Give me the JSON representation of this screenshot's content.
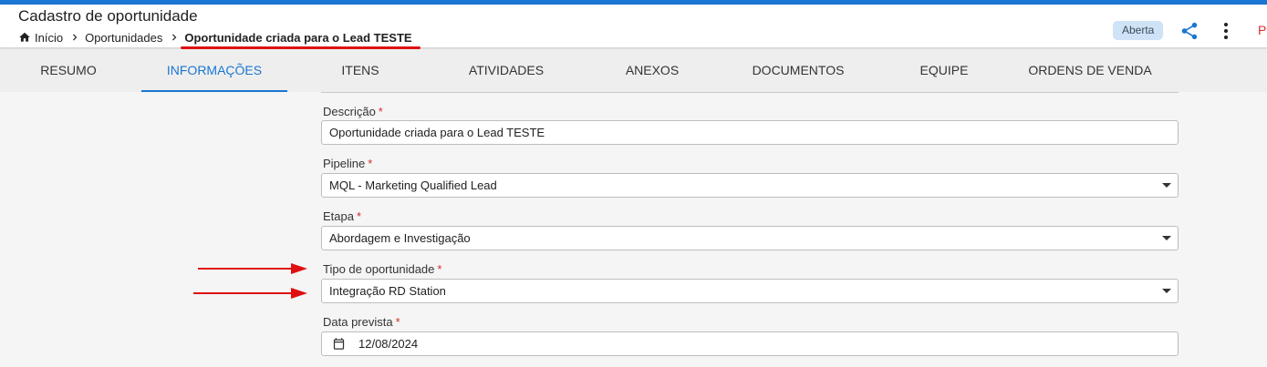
{
  "header": {
    "title": "Cadastro de oportunidade",
    "breadcrumb": {
      "home": "Início",
      "section": "Oportunidades",
      "current": "Oportunidade criada para o Lead TESTE"
    },
    "status": "Aberta",
    "cut_label": "P",
    "icons": {
      "home": "home-icon",
      "share": "share-icon",
      "more": "more-vertical-icon"
    }
  },
  "tabs": [
    {
      "label": "RESUMO"
    },
    {
      "label": "INFORMAÇÕES",
      "active": true
    },
    {
      "label": "ITENS"
    },
    {
      "label": "ATIVIDADES"
    },
    {
      "label": "ANEXOS"
    },
    {
      "label": "DOCUMENTOS"
    },
    {
      "label": "EQUIPE"
    },
    {
      "label": "ORDENS DE VENDA"
    }
  ],
  "form": {
    "descricao": {
      "label": "Descrição",
      "required": "*",
      "value": "Oportunidade criada para o Lead TESTE"
    },
    "pipeline": {
      "label": "Pipeline",
      "required": "*",
      "value": "MQL - Marketing Qualified Lead"
    },
    "etapa": {
      "label": "Etapa",
      "required": "*",
      "value": "Abordagem e Investigação"
    },
    "tipo": {
      "label": "Tipo de oportunidade",
      "required": "*",
      "value": "Integração RD Station"
    },
    "data": {
      "label": "Data prevista",
      "required": "*",
      "value": "12/08/2024"
    }
  },
  "colors": {
    "accent": "#1976d2",
    "required": "#d32f2f",
    "annotation": "#e01010",
    "badge_bg": "#cfe3f7"
  }
}
